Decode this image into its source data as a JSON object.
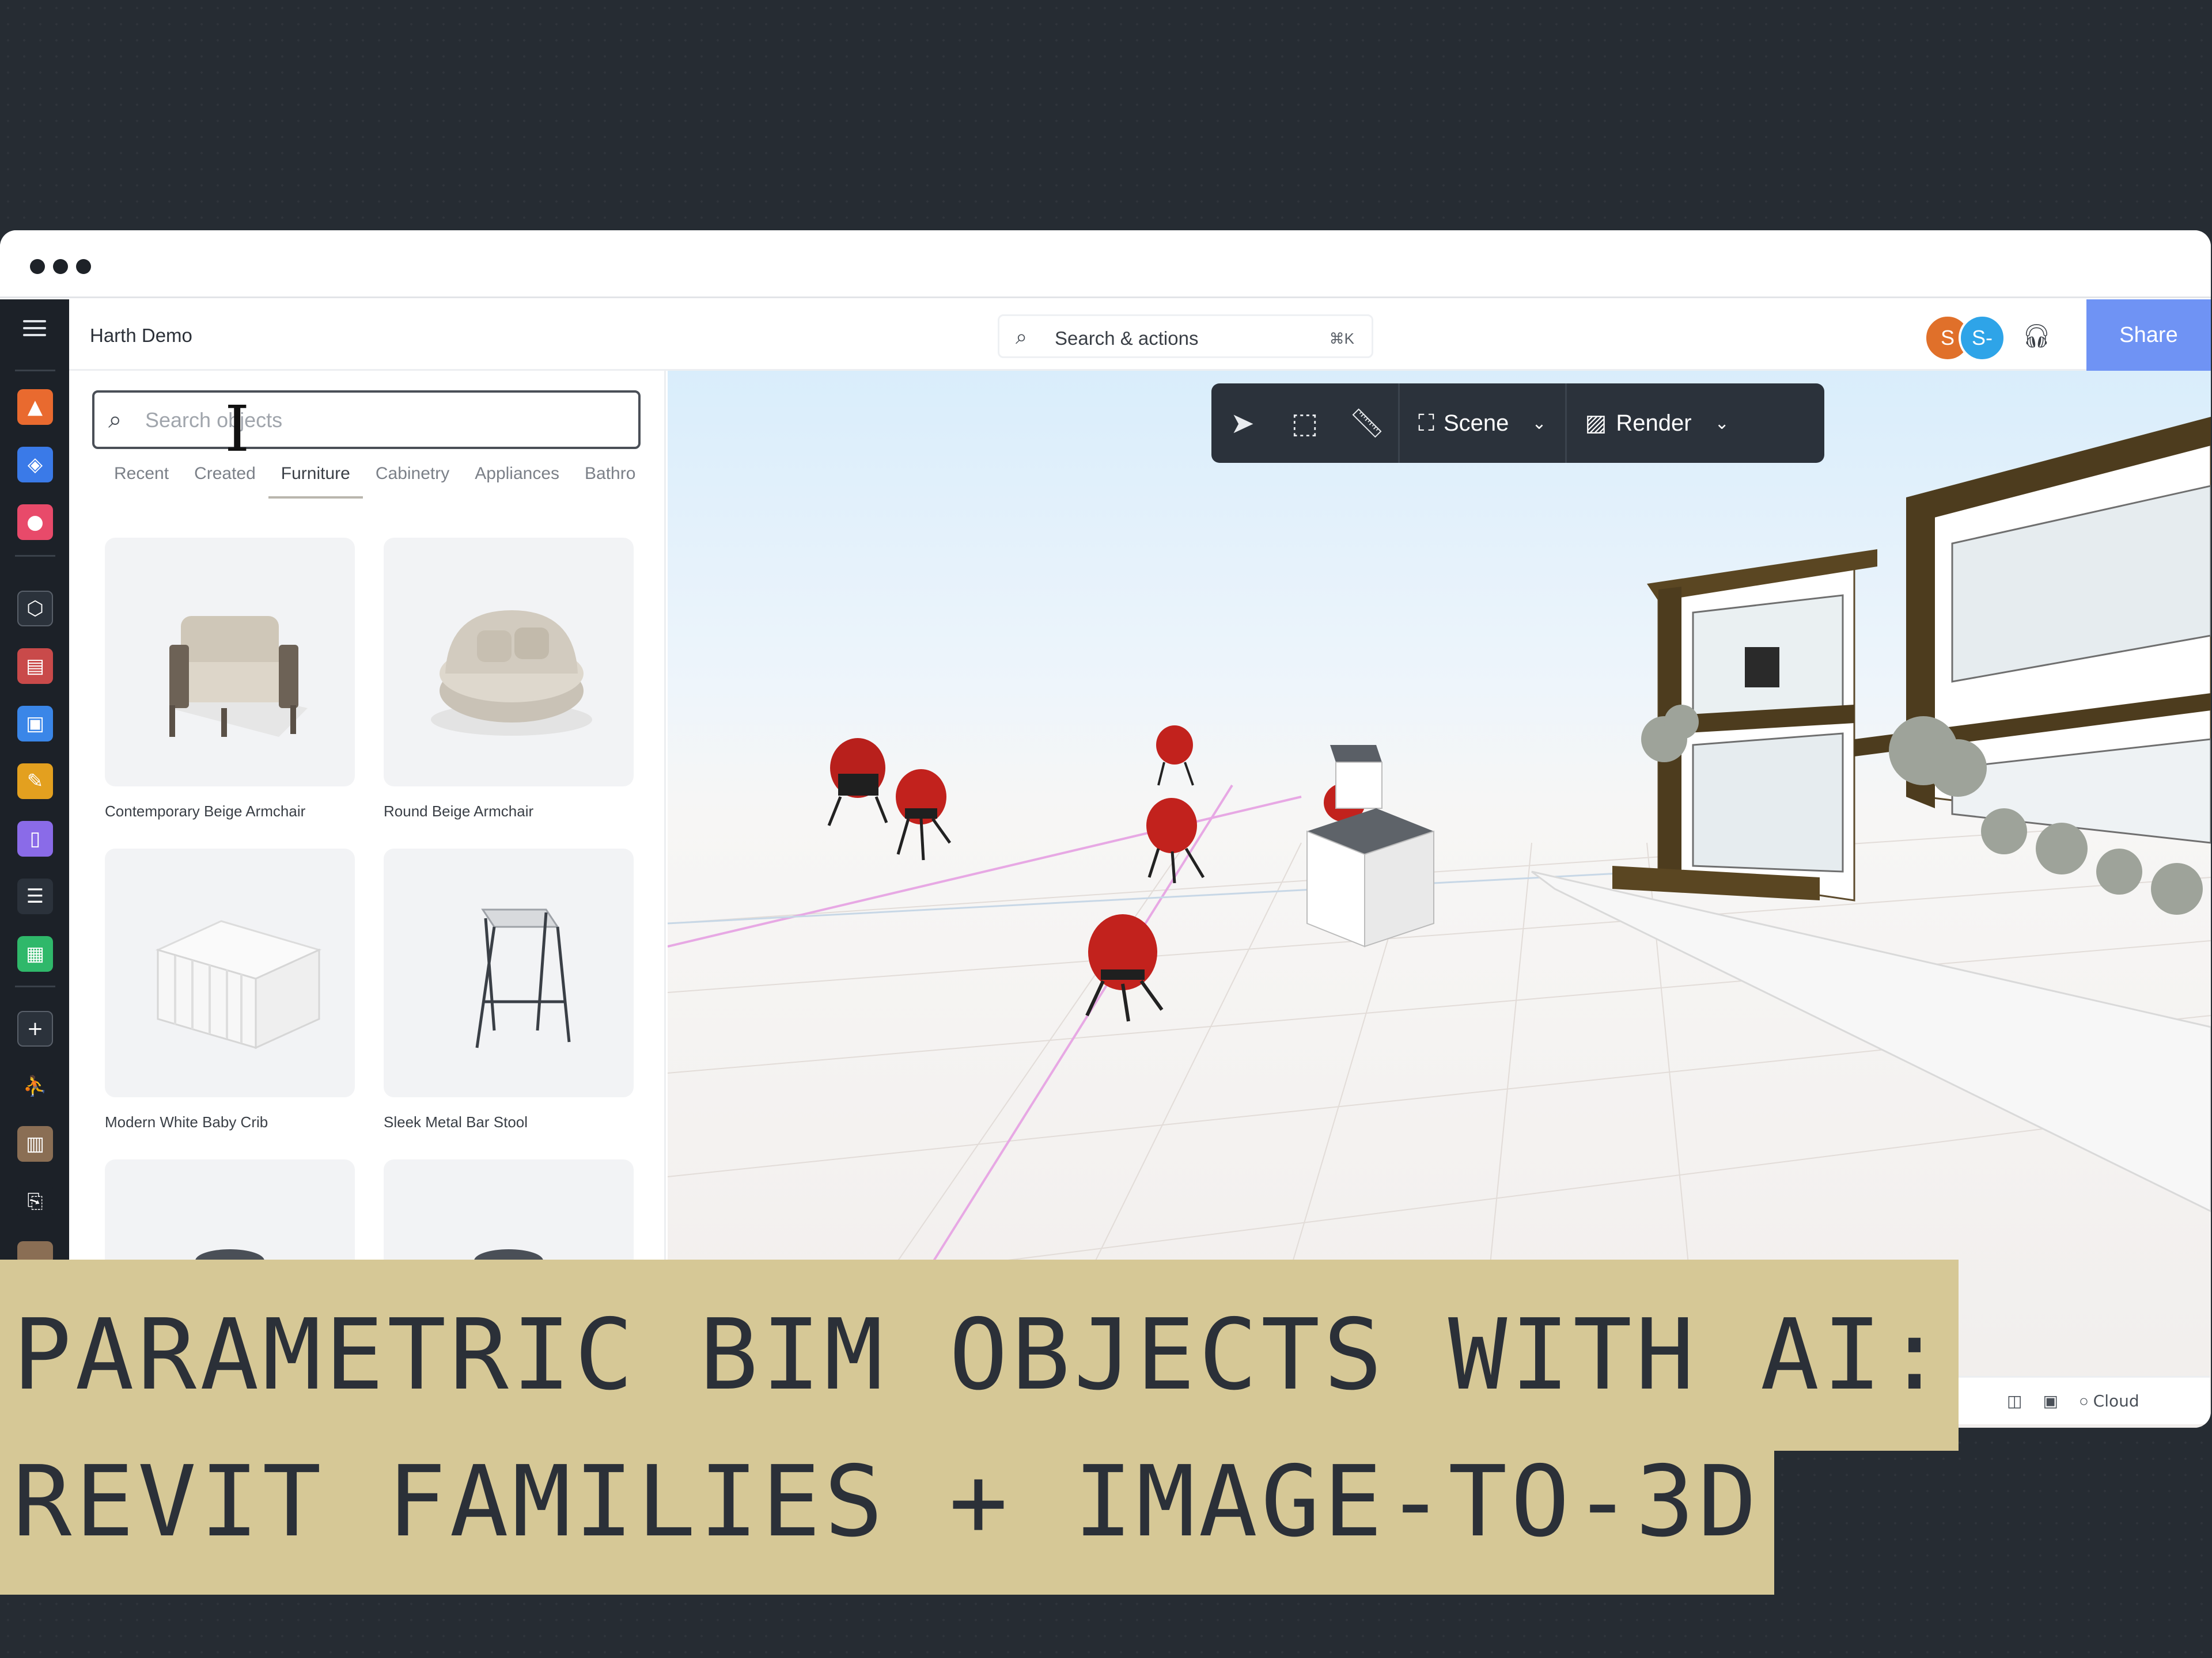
{
  "app": {
    "project_title": "Harth Demo",
    "search_actions": {
      "label": "Search & actions",
      "shortcut": "⌘K"
    },
    "avatars": [
      {
        "initials": "S",
        "color": "#e0702a"
      },
      {
        "initials": "S-",
        "color": "#2ea4e8"
      }
    ],
    "share_label": "Share"
  },
  "sidebar_rail": {
    "items": [
      {
        "icon": "presentation-icon",
        "color": "#e96a2f"
      },
      {
        "icon": "layers-icon",
        "color": "#3a7ae8"
      },
      {
        "icon": "shapes-icon",
        "color": "#e84a6a"
      },
      {
        "icon": "cube-icon",
        "color": "#2b323b"
      },
      {
        "icon": "furniture-icon",
        "color": "#c94a4a"
      },
      {
        "icon": "image-icon",
        "color": "#3a86e8"
      },
      {
        "icon": "edit-icon",
        "color": "#e3a01f"
      },
      {
        "icon": "document-icon",
        "color": "#8a6be8"
      },
      {
        "icon": "table-icon",
        "color": "#2b323b"
      },
      {
        "icon": "sheet-icon",
        "color": "#2fb86a"
      },
      {
        "icon": "plus-icon",
        "color": "#2b323b"
      },
      {
        "icon": "person-icon",
        "color": "#2b323b"
      },
      {
        "icon": "thumbnail-icon",
        "color": "#8a6e54"
      },
      {
        "icon": "file-icon",
        "color": "#2b323b"
      }
    ]
  },
  "object_panel": {
    "search_placeholder": "Search objects",
    "tabs": [
      "Recent",
      "Created",
      "Furniture",
      "Cabinetry",
      "Appliances",
      "Bathro"
    ],
    "active_tab": "Furniture",
    "items": [
      {
        "name": "Contemporary Beige Armchair"
      },
      {
        "name": "Round Beige Armchair"
      },
      {
        "name": "Modern White Baby Crib"
      },
      {
        "name": "Sleek Metal Bar Stool"
      },
      {
        "name": ""
      },
      {
        "name": ""
      }
    ]
  },
  "toolbar": {
    "tools": [
      "select-arrow-icon",
      "marquee-select-icon",
      "ruler-icon"
    ],
    "scene_label": "Scene",
    "render_label": "Render"
  },
  "statusbar": {
    "cloud_label": "Cloud"
  },
  "banner": {
    "line1": "PARAMETRIC BIM OBJECTS WITH AI:",
    "line2": "REVIT FAMILIES + IMAGE-TO-3D"
  }
}
